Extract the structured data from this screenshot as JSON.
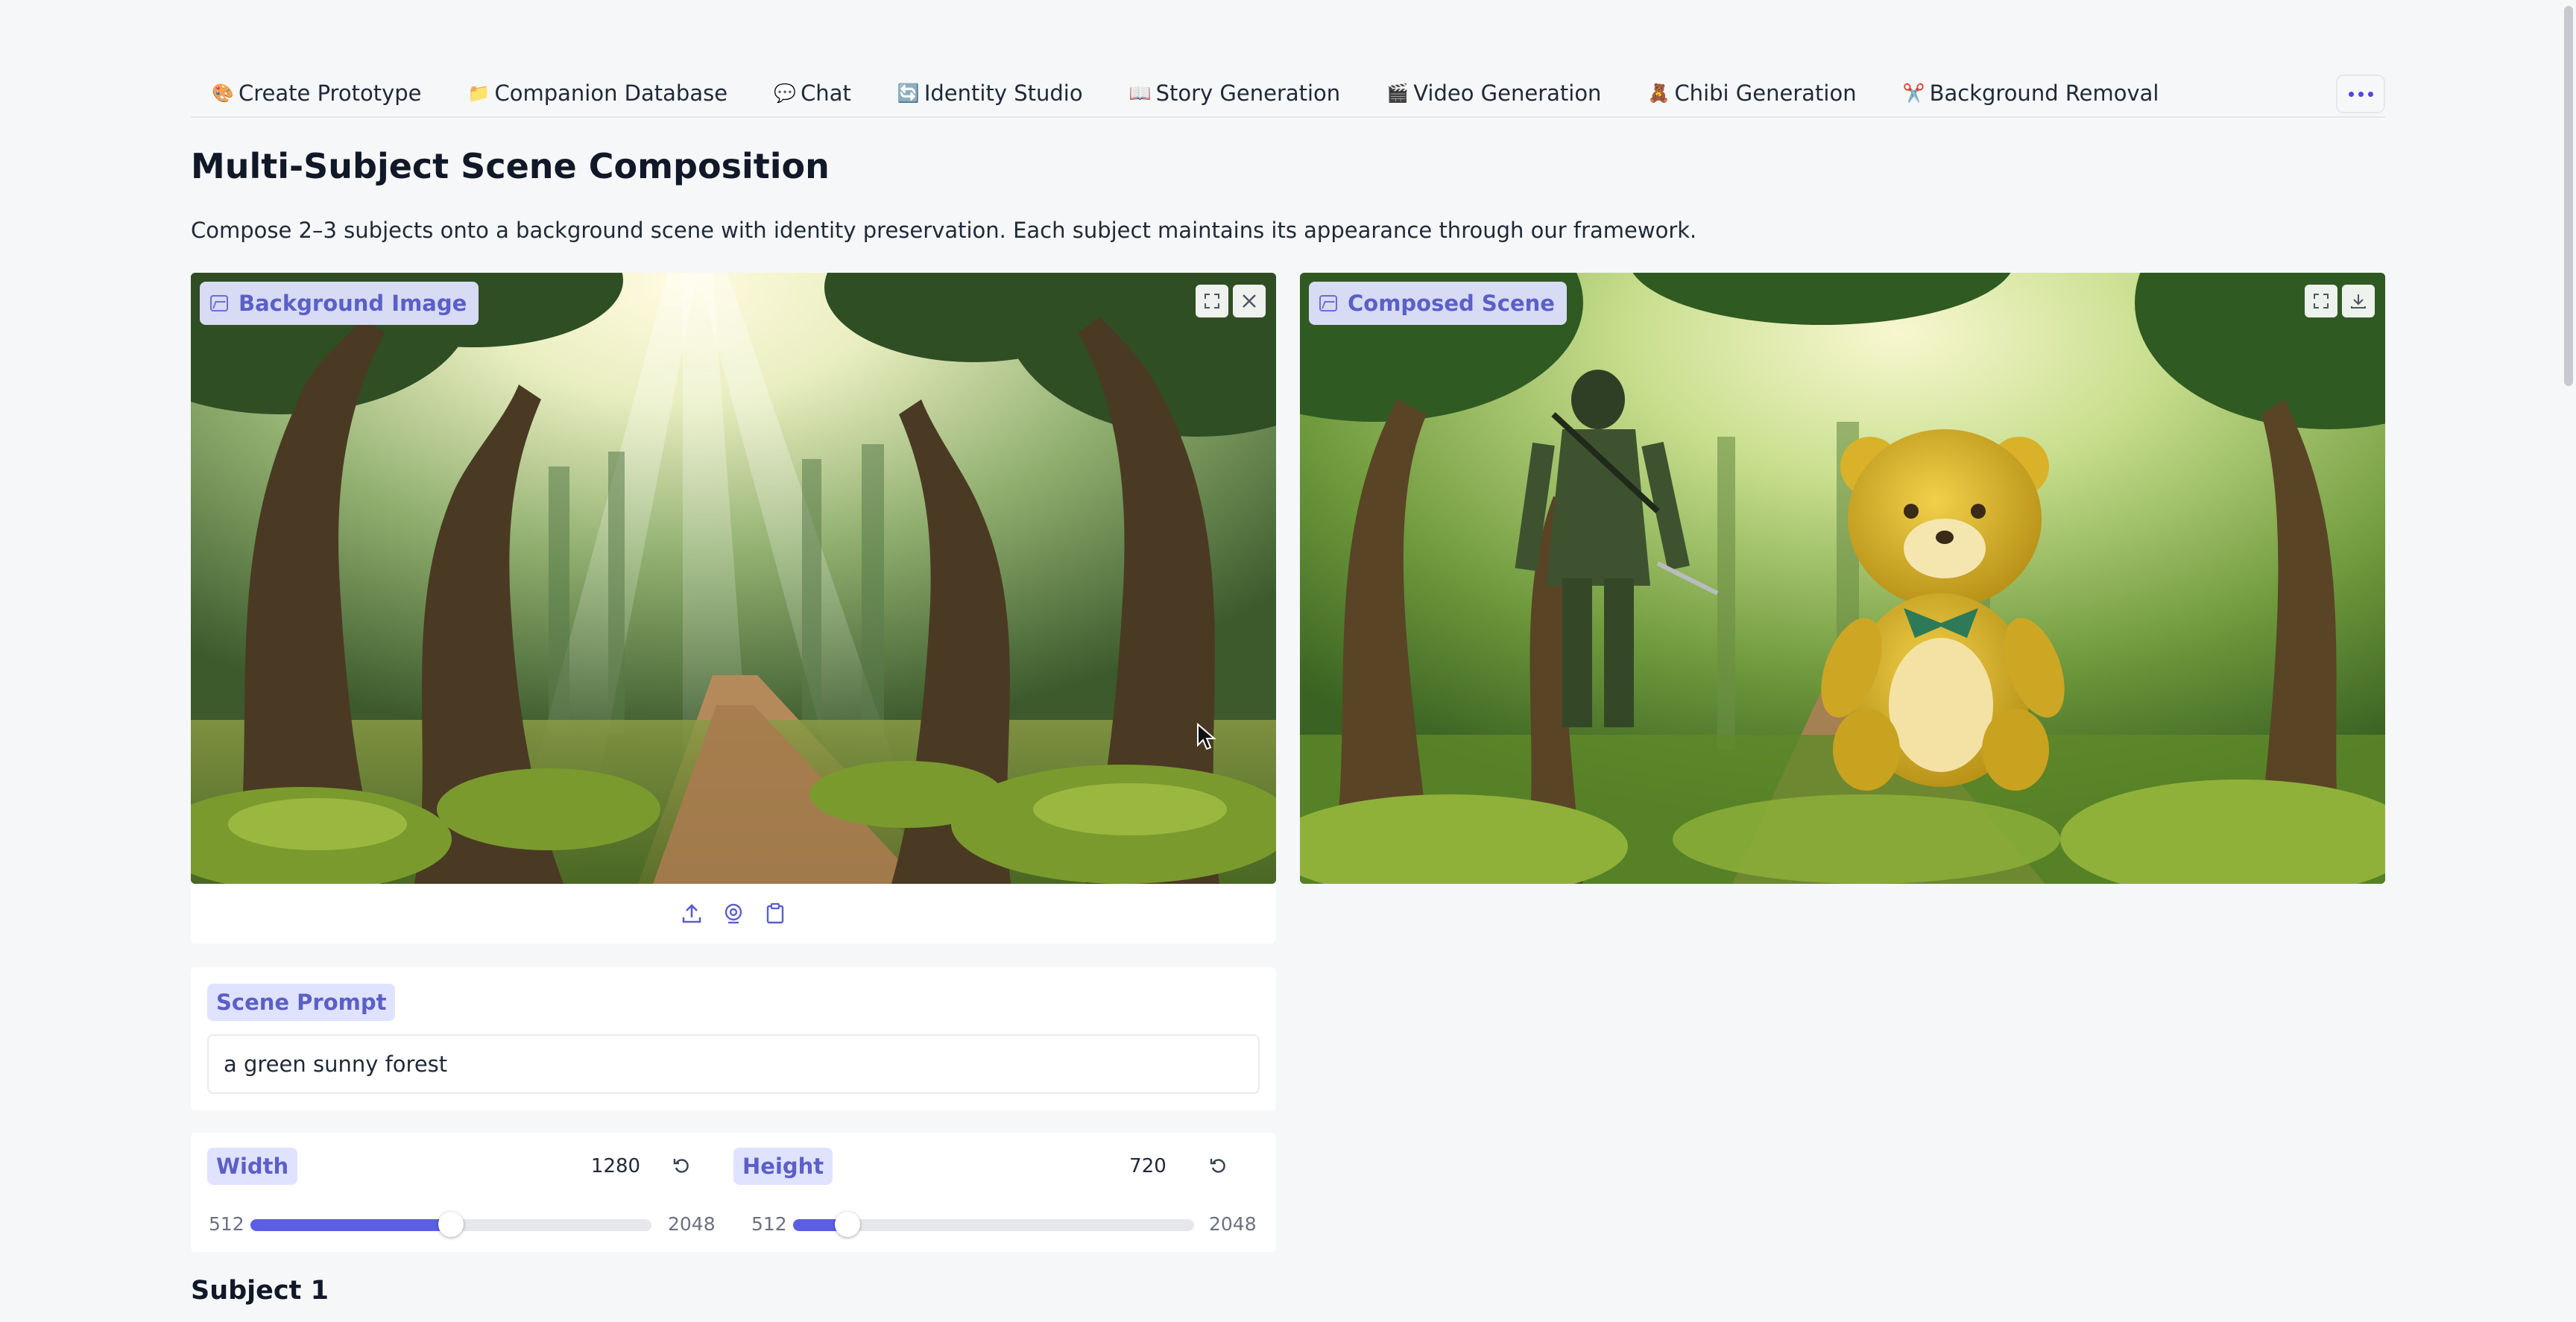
{
  "tabs": [
    {
      "label": "Create Prototype",
      "icon": "palette-icon",
      "glyph": "🎨"
    },
    {
      "label": "Companion Database",
      "icon": "database-icon",
      "glyph": "📁"
    },
    {
      "label": "Chat",
      "icon": "chat-bubble-icon",
      "glyph": "💬"
    },
    {
      "label": "Identity Studio",
      "icon": "refresh-icon",
      "glyph": "🔄"
    },
    {
      "label": "Story Generation",
      "icon": "book-icon",
      "glyph": "📖"
    },
    {
      "label": "Video Generation",
      "icon": "clapper-icon",
      "glyph": "🎬"
    },
    {
      "label": "Chibi Generation",
      "icon": "teddy-bear-icon",
      "glyph": "🧸"
    },
    {
      "label": "Background Removal",
      "icon": "scissors-icon",
      "glyph": "✂️"
    }
  ],
  "page": {
    "title": "Multi-Subject Scene Composition",
    "description": "Compose 2–3 subjects onto a background scene with identity preservation. Each subject maintains its appearance through our framework."
  },
  "background_image": {
    "label": "Background Image"
  },
  "composed_scene": {
    "label": "Composed Scene"
  },
  "scene_prompt": {
    "label": "Scene Prompt",
    "value": "a green sunny forest"
  },
  "width": {
    "label": "Width",
    "value": "1280",
    "min": "512",
    "max": "2048",
    "fraction": 0.5
  },
  "height": {
    "label": "Height",
    "value": "720",
    "min": "512",
    "max": "2048",
    "fraction": 0.1354
  },
  "subject1": {
    "heading": "Subject 1"
  },
  "colors": {
    "accent": "#5b5fe6",
    "chip_bg": "#e0e3ff",
    "chip_text": "#5b5fc7"
  }
}
